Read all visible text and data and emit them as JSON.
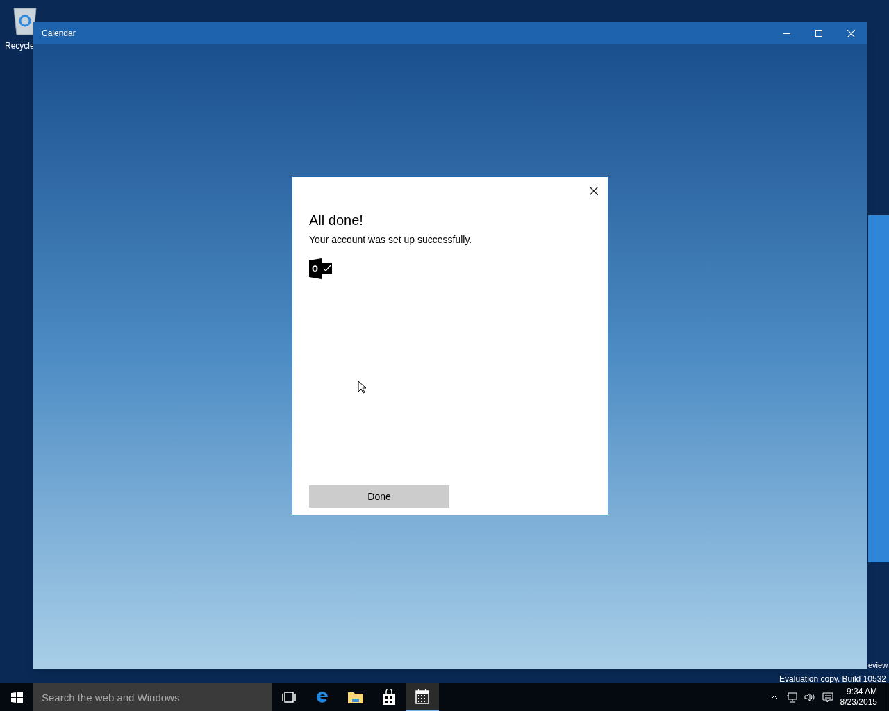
{
  "desktop": {
    "icons": [
      {
        "label": "Recycle"
      }
    ],
    "watermark_lines": [
      "eview",
      "Evaluation copy. Build 10532"
    ]
  },
  "window": {
    "title": "Calendar"
  },
  "dialog": {
    "title": "All done!",
    "message": "Your account was set up successfully.",
    "button": "Done"
  },
  "taskbar": {
    "search": {
      "placeholder": "Search the web and Windows"
    },
    "apps": [
      {
        "kind": "taskview",
        "selected": false
      },
      {
        "kind": "browser",
        "selected": false
      },
      {
        "kind": "folder",
        "selected": false
      },
      {
        "kind": "store",
        "selected": false
      },
      {
        "kind": "calendar",
        "selected": true
      }
    ],
    "time": "9:34 AM",
    "date": "8/23/2015"
  }
}
